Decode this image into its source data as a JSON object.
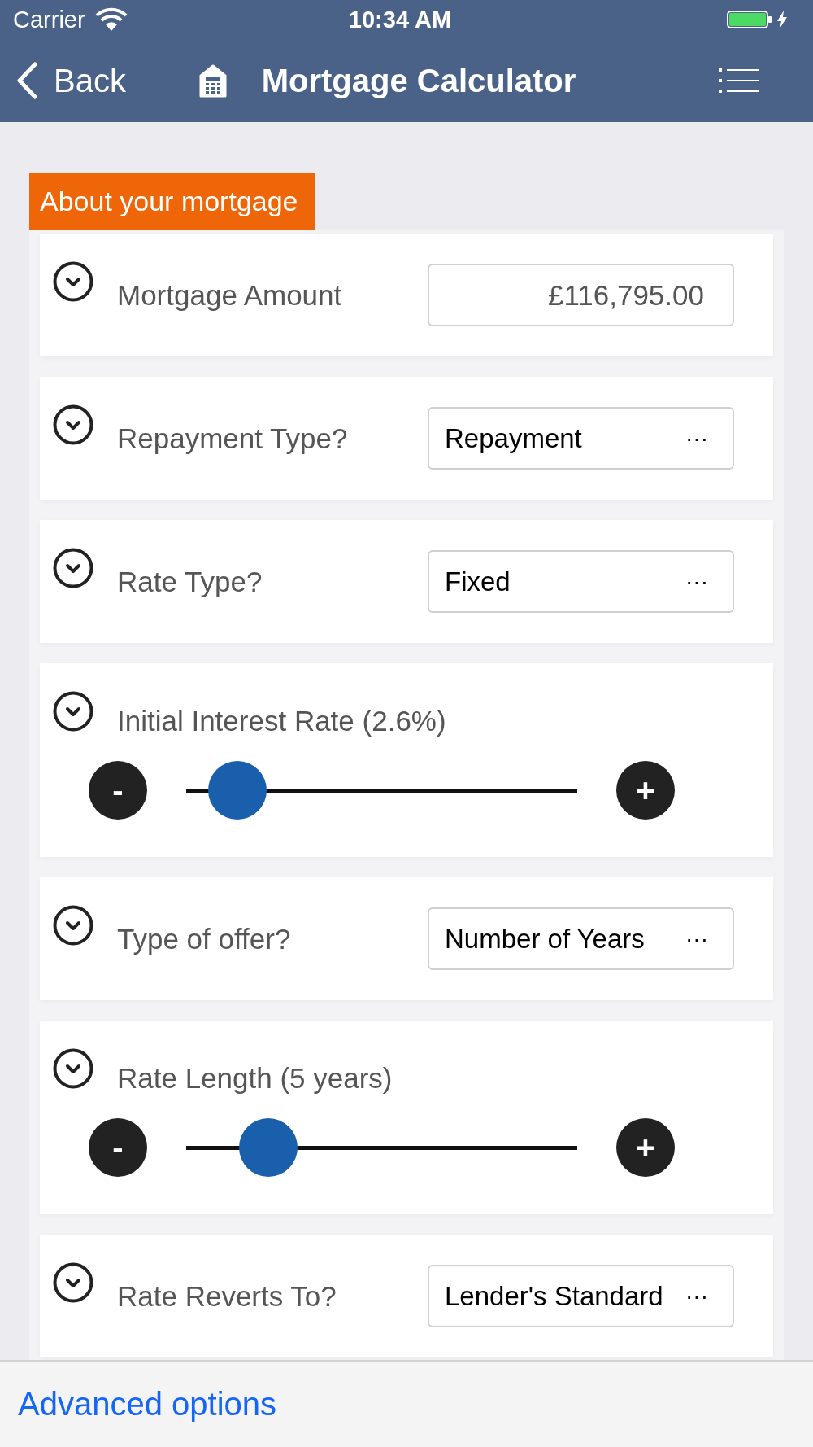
{
  "status_bar": {
    "carrier": "Carrier",
    "time": "10:34 AM"
  },
  "nav_bar": {
    "back": "Back",
    "title": "Mortgage Calculator"
  },
  "section": {
    "title": "About your mortgage"
  },
  "fields": [
    {
      "kind": "input",
      "label": "Mortgage Amount",
      "value": "£116,795.00"
    },
    {
      "kind": "select",
      "label": "Repayment Type?",
      "value": "Repayment",
      "more": "···"
    },
    {
      "kind": "select",
      "label": "Rate Type?",
      "value": "Fixed",
      "more": "···"
    },
    {
      "kind": "slider",
      "label": "Initial Interest Rate (2.6%)",
      "level": 0.13,
      "minus": "-",
      "plus": "+"
    },
    {
      "kind": "select",
      "label": "Type of offer?",
      "value": "Number of Years",
      "more": "···"
    },
    {
      "kind": "slider",
      "label": "Rate Length (5 years)",
      "level": 0.21,
      "minus": "-",
      "plus": "+"
    },
    {
      "kind": "select",
      "label": "Rate Reverts To?",
      "value": "Lender's Standard",
      "more": "···"
    }
  ],
  "footer": {
    "link": "Advanced options"
  }
}
